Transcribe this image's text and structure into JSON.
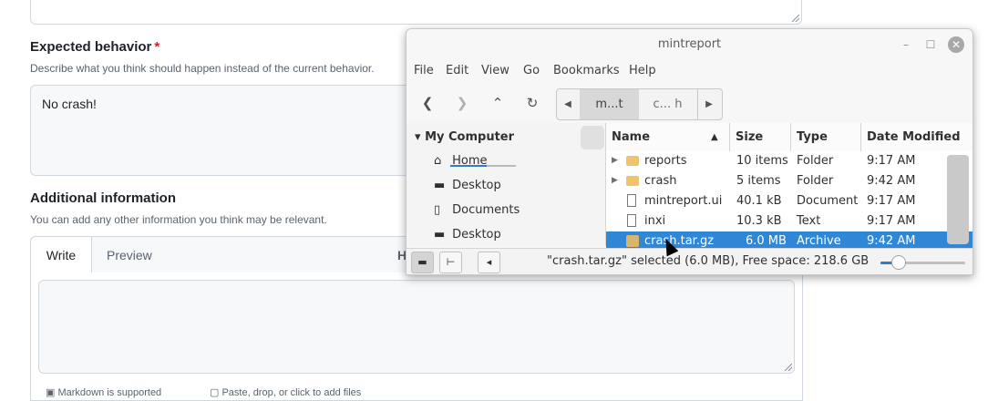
{
  "form": {
    "expected_label": "Expected behavior",
    "required_mark": "*",
    "expected_desc": "Describe what you think should happen instead of the current behavior.",
    "expected_value": "No crash!",
    "additional_label": "Additional information",
    "additional_desc": "You can add any other information you think may be relevant.",
    "tabs": [
      {
        "label": "Write"
      },
      {
        "label": "Preview"
      },
      {
        "label": "H"
      }
    ],
    "editor_value": "",
    "footer_markdown": "Markdown is supported",
    "footer_paste": "Paste, drop, or click to add files"
  },
  "window": {
    "title": "mintreport",
    "controls": {
      "minimize": "–",
      "maximize": "☐",
      "close": "✕"
    },
    "menu": [
      "File",
      "Edit",
      "View",
      "Go",
      "Bookmarks",
      "Help"
    ],
    "breadcrumbs": [
      {
        "label": "m...t",
        "active": true
      },
      {
        "label": "c... h",
        "active": false
      }
    ],
    "sidebar": {
      "header": "My Computer",
      "items": [
        {
          "label": "Home",
          "icon": "home-icon"
        },
        {
          "label": "Desktop",
          "icon": "desktop-icon"
        },
        {
          "label": "Documents",
          "icon": "documents-icon"
        },
        {
          "label": "Desktop",
          "icon": "desktop-icon"
        }
      ]
    },
    "columns": {
      "name": "Name",
      "size": "Size",
      "type": "Type",
      "date": "Date Modified"
    },
    "files": [
      {
        "name": "reports",
        "size": "10 items",
        "type": "Folder",
        "date": "9:17 AM",
        "kind": "folder",
        "expandable": true
      },
      {
        "name": "crash",
        "size": "5 items",
        "type": "Folder",
        "date": "9:42 AM",
        "kind": "folder",
        "expandable": true
      },
      {
        "name": "mintreport.ui",
        "size": "40.1 kB",
        "type": "Document",
        "date": "9:17 AM",
        "kind": "document",
        "expandable": false
      },
      {
        "name": "inxi",
        "size": "10.3 kB",
        "type": "Text",
        "date": "9:17 AM",
        "kind": "text",
        "expandable": false
      },
      {
        "name": "crash.tar.gz",
        "size": "6.0 MB",
        "type": "Archive",
        "date": "9:42 AM",
        "kind": "archive",
        "expandable": false,
        "selected": true
      }
    ],
    "status_text": "\"crash.tar.gz\" selected (6.0 MB), Free space: 218.6 GB",
    "zoom_level": 0.2
  },
  "colors": {
    "selection": "#2f87d6",
    "accent": "#2f7bd4",
    "required": "#cf222e"
  }
}
